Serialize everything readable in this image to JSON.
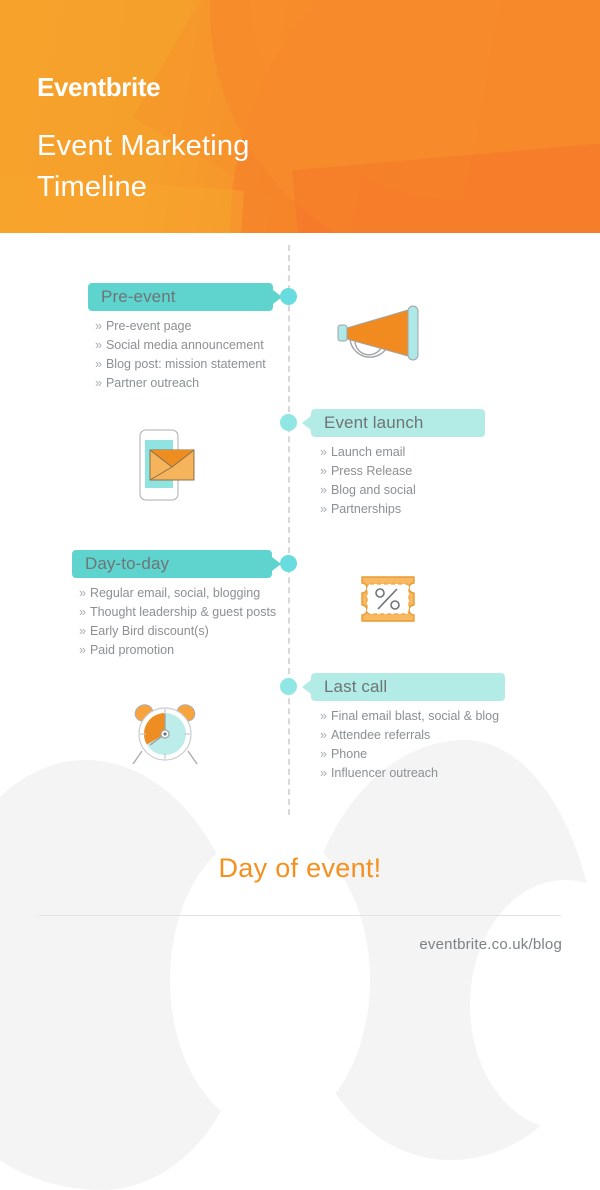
{
  "header": {
    "brand": "Eventbrite",
    "title_line1": "Event Marketing",
    "title_line2": "Timeline",
    "bg_color_left": "#F6A22B",
    "bg_color_right": "#F3652B",
    "text_color": "#FFFFFF"
  },
  "theme": {
    "teal_strong": "#5FD3CE",
    "teal_pale": "#B3EBE6",
    "dot_color": "#68DCDE",
    "orange": "#F5901E",
    "body_text": "#8A9093",
    "label_text": "#6E7577"
  },
  "timeline": {
    "stages": [
      {
        "label": "Pre-event",
        "side": "left",
        "icon": "megaphone-icon",
        "bullets": [
          "Pre-event page",
          "Social media announcement",
          "Blog post: mission statement",
          "Partner outreach"
        ]
      },
      {
        "label": "Event launch",
        "side": "right",
        "icon": "mobile-email-icon",
        "bullets": [
          "Launch email",
          "Press Release",
          "Blog and social",
          "Partnerships"
        ]
      },
      {
        "label": "Day-to-day",
        "side": "left",
        "icon": "discount-ticket-icon",
        "bullets": [
          "Regular email, social, blogging",
          "Thought leadership & guest posts",
          "Early Bird discount(s)",
          "Paid promotion"
        ]
      },
      {
        "label": "Last call",
        "side": "right",
        "icon": "alarm-clock-icon",
        "bullets": [
          "Final email blast, social & blog",
          "Attendee referrals",
          "Phone",
          "Influencer outreach"
        ]
      }
    ],
    "bullet_marker": "»"
  },
  "footer": {
    "day_of_event": "Day of event!",
    "site_url": "eventbrite.co.uk/blog"
  }
}
